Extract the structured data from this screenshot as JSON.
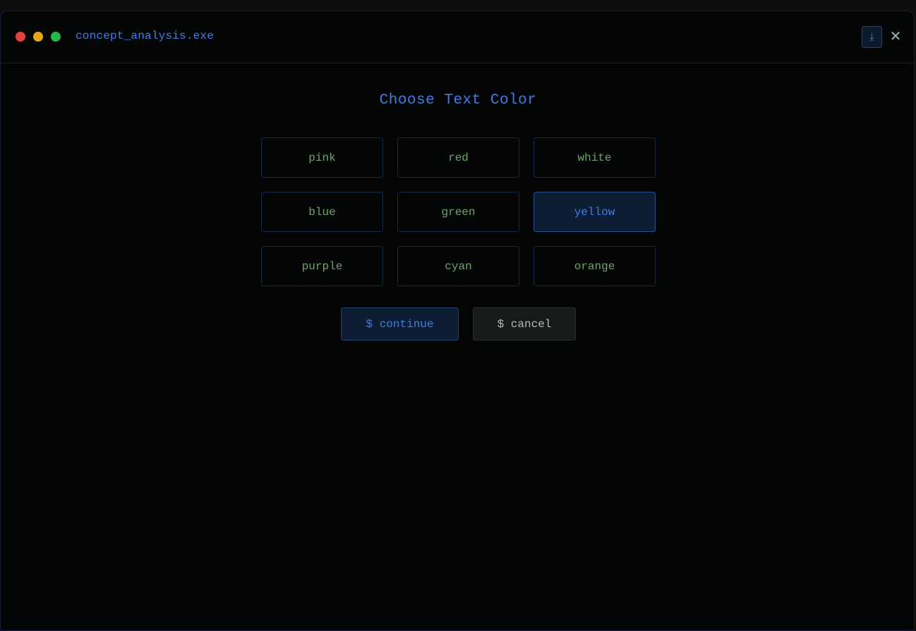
{
  "window": {
    "title": "concept_analysis.exe",
    "download_icon": "download-icon",
    "download_glyph": "⤓",
    "close_icon": "close-icon",
    "close_glyph": "✕"
  },
  "dialog": {
    "heading": "Choose Text Color",
    "options": [
      {
        "label": "pink",
        "selected": false
      },
      {
        "label": "red",
        "selected": false
      },
      {
        "label": "white",
        "selected": false
      },
      {
        "label": "blue",
        "selected": false
      },
      {
        "label": "green",
        "selected": false
      },
      {
        "label": "yellow",
        "selected": true
      },
      {
        "label": "purple",
        "selected": false
      },
      {
        "label": "cyan",
        "selected": false
      },
      {
        "label": "orange",
        "selected": false
      }
    ],
    "continue_label": "$ continue",
    "cancel_label": "$ cancel"
  },
  "colors": {
    "accent": "#3f7ee6",
    "option_text": "#6ea36b",
    "traffic_red": "#e2433f",
    "traffic_yellow": "#e3a816",
    "traffic_green": "#23b84a"
  }
}
